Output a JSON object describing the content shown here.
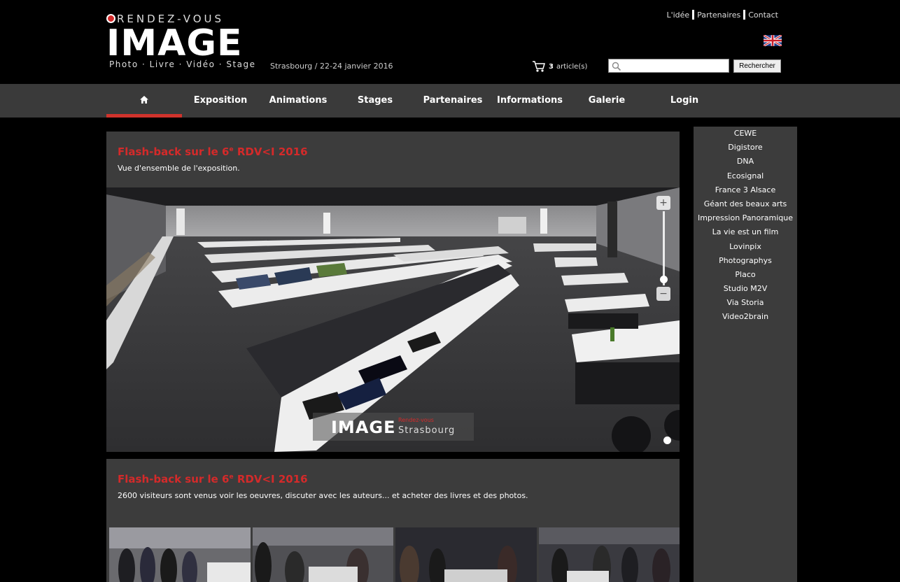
{
  "logo": {
    "top_text": "RENDEZ-VOUS",
    "main_text": "IMAGE",
    "subtitle": "Photo · Livre · Vidéo · Stage"
  },
  "header": {
    "dates": "Strasbourg / 22-24 janvier 2016",
    "top_links": [
      "L'idée",
      "Partenaires",
      "Contact"
    ],
    "cart": {
      "count": "3",
      "label": "article(s)"
    },
    "search": {
      "placeholder": "",
      "button_label": "Rechercher"
    }
  },
  "nav": {
    "items": [
      "Exposition",
      "Animations",
      "Stages",
      "Partenaires",
      "Informations",
      "Galerie",
      "Login"
    ]
  },
  "panels": [
    {
      "title_prefix": "Flash-back sur le 6",
      "title_sup": "e",
      "title_suffix": " RDV<I 2016",
      "description": "Vue d'ensemble de l'exposition."
    },
    {
      "title_prefix": "Flash-back sur le 6",
      "title_sup": "e",
      "title_suffix": " RDV<I 2016",
      "description": "2600 visiteurs sont venus voir les oeuvres, discuter avec les auteurs... et acheter des livres et des photos."
    }
  ],
  "watermark": {
    "main": "IMAGE",
    "red_text": "Rendez-vous",
    "city": "Strasbourg"
  },
  "sidebar": {
    "partners": [
      "CEWE",
      "Digistore",
      "DNA",
      "Ecosignal",
      "France 3 Alsace",
      "Géant des beaux arts",
      "Impression Panoramique",
      "La vie est un film",
      "Lovinpix",
      "Photographys",
      "Placo",
      "Studio M2V",
      "Via Storia",
      "Video2brain"
    ]
  },
  "colors": {
    "accent_red": "#d42a2a",
    "nav_bg": "#3a3a3a",
    "panel_bg": "#3c3c3c"
  }
}
